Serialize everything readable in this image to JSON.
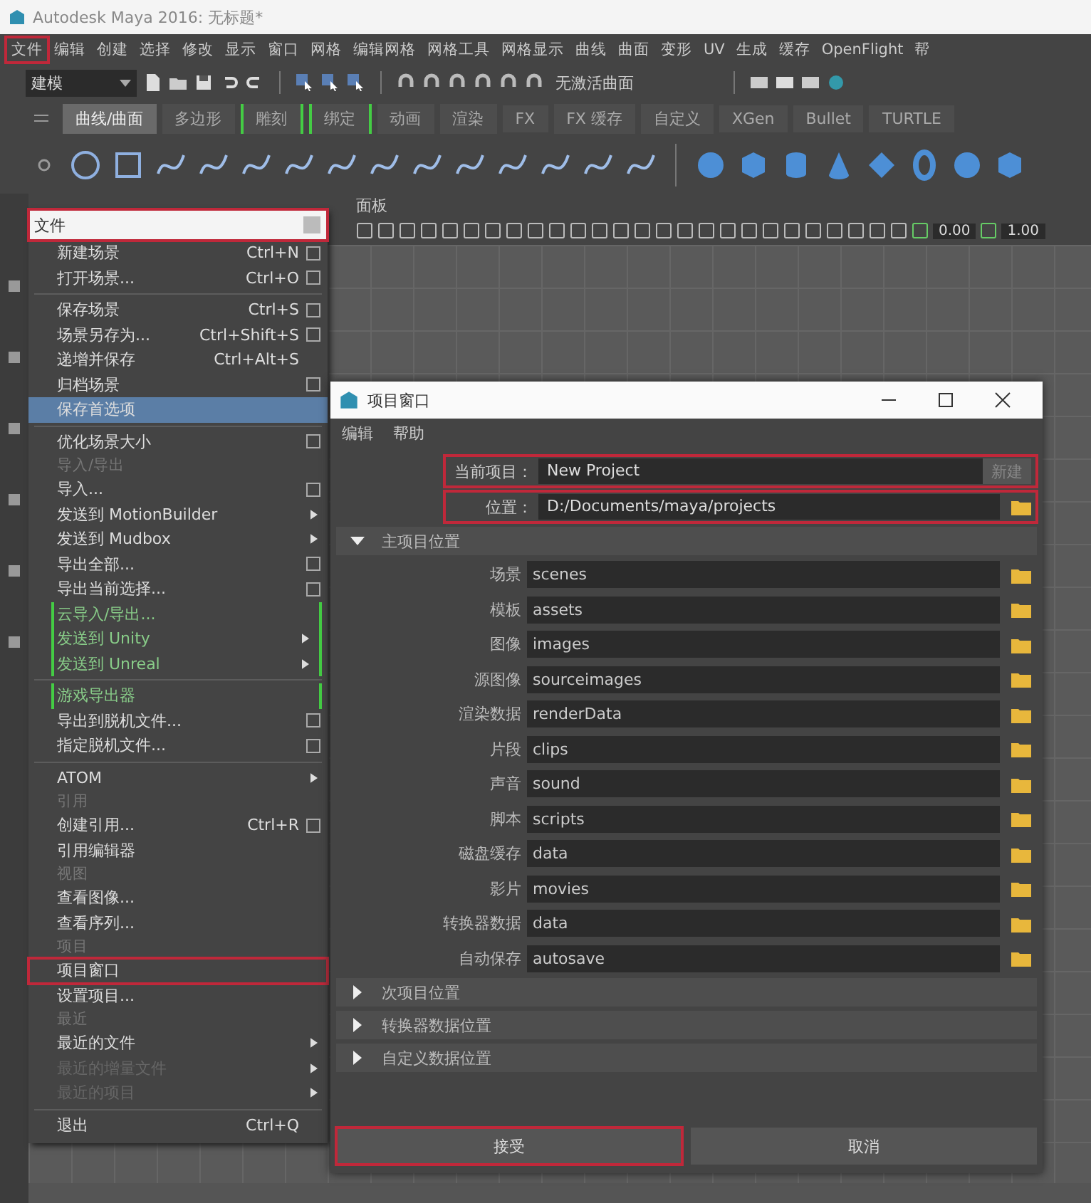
{
  "window": {
    "title": "Autodesk Maya 2016: 无标题*"
  },
  "menu_bar": [
    {
      "label": "文件",
      "highlighted": true
    },
    {
      "label": "编辑",
      "highlighted": false
    },
    {
      "label": "创建",
      "highlighted": false
    },
    {
      "label": "选择",
      "highlighted": false
    },
    {
      "label": "修改",
      "highlighted": false
    },
    {
      "label": "显示",
      "highlighted": false
    },
    {
      "label": "窗口",
      "highlighted": false
    },
    {
      "label": "网格",
      "highlighted": false
    },
    {
      "label": "编辑网格",
      "highlighted": false
    },
    {
      "label": "网格工具",
      "highlighted": false
    },
    {
      "label": "网格显示",
      "highlighted": false
    },
    {
      "label": "曲线",
      "highlighted": false
    },
    {
      "label": "曲面",
      "highlighted": false
    },
    {
      "label": "变形",
      "highlighted": false
    },
    {
      "label": "UV",
      "highlighted": false
    },
    {
      "label": "生成",
      "highlighted": false
    },
    {
      "label": "缓存",
      "highlighted": false
    },
    {
      "label": "OpenFlight",
      "highlighted": false
    },
    {
      "label": "帮",
      "highlighted": false
    }
  ],
  "status_line": {
    "mode": "建模",
    "surface_status": "无激活曲面"
  },
  "shelf_tabs": [
    {
      "label": "曲线/曲面",
      "selected": true,
      "kind": "plain"
    },
    {
      "label": "多边形",
      "selected": false,
      "kind": "plain"
    },
    {
      "label": "雕刻",
      "selected": false,
      "kind": "bracketed"
    },
    {
      "label": "绑定",
      "selected": false,
      "kind": "bracketed"
    },
    {
      "label": "动画",
      "selected": false,
      "kind": "plain"
    },
    {
      "label": "渲染",
      "selected": false,
      "kind": "plain"
    },
    {
      "label": "FX",
      "selected": false,
      "kind": "plain"
    },
    {
      "label": "FX 缓存",
      "selected": false,
      "kind": "plain"
    },
    {
      "label": "自定义",
      "selected": false,
      "kind": "plain"
    },
    {
      "label": "XGen",
      "selected": false,
      "kind": "plain"
    },
    {
      "label": "Bullet",
      "selected": false,
      "kind": "plain"
    },
    {
      "label": "TURTLE",
      "selected": false,
      "kind": "plain"
    }
  ],
  "panel_menu": [
    "面板"
  ],
  "panel_toolbar": {
    "values": [
      "0.00",
      "1.00"
    ]
  },
  "file_menu": {
    "title": "文件",
    "highlighted": true,
    "items": [
      {
        "kind": "item",
        "label": "新建场景",
        "shortcut": "Ctrl+N",
        "option_box": true,
        "submenu": false,
        "selected": false,
        "highlighted": false
      },
      {
        "kind": "item",
        "label": "打开场景...",
        "shortcut": "Ctrl+O",
        "option_box": true,
        "submenu": false,
        "selected": false,
        "highlighted": false
      },
      {
        "kind": "divider"
      },
      {
        "kind": "item",
        "label": "保存场景",
        "shortcut": "Ctrl+S",
        "option_box": true,
        "submenu": false,
        "selected": false,
        "highlighted": false
      },
      {
        "kind": "item",
        "label": "场景另存为...",
        "shortcut": "Ctrl+Shift+S",
        "option_box": true,
        "submenu": false,
        "selected": false,
        "highlighted": false
      },
      {
        "kind": "item",
        "label": "递增并保存",
        "shortcut": "Ctrl+Alt+S",
        "option_box": false,
        "submenu": false,
        "selected": false,
        "highlighted": false
      },
      {
        "kind": "item",
        "label": "归档场景",
        "option_box": true,
        "submenu": false,
        "selected": false,
        "highlighted": false
      },
      {
        "kind": "item",
        "label": "保存首选项",
        "option_box": false,
        "submenu": false,
        "selected": true,
        "highlighted": false
      },
      {
        "kind": "divider"
      },
      {
        "kind": "item",
        "label": "优化场景大小",
        "option_box": true,
        "submenu": false,
        "selected": false,
        "highlighted": false
      },
      {
        "kind": "section",
        "label": "导入/导出"
      },
      {
        "kind": "item",
        "label": "导入...",
        "option_box": true,
        "submenu": false,
        "selected": false,
        "highlighted": false
      },
      {
        "kind": "item",
        "label": "发送到 MotionBuilder",
        "option_box": false,
        "submenu": true,
        "selected": false,
        "highlighted": false
      },
      {
        "kind": "item",
        "label": "发送到 Mudbox",
        "option_box": false,
        "submenu": true,
        "selected": false,
        "highlighted": false
      },
      {
        "kind": "item",
        "label": "导出全部...",
        "option_box": true,
        "submenu": false,
        "selected": false,
        "highlighted": false
      },
      {
        "kind": "item",
        "label": "导出当前选择...",
        "option_box": true,
        "submenu": false,
        "selected": false,
        "highlighted": false
      },
      {
        "kind": "custom",
        "label": "云导入/导出...",
        "option_box": false,
        "submenu": false,
        "selected": false,
        "highlighted": false
      },
      {
        "kind": "custom",
        "label": "发送到 Unity",
        "option_box": false,
        "submenu": true,
        "selected": false,
        "highlighted": false
      },
      {
        "kind": "custom",
        "label": "发送到 Unreal",
        "option_box": false,
        "submenu": true,
        "selected": false,
        "highlighted": false
      },
      {
        "kind": "divider"
      },
      {
        "kind": "custom",
        "label": "游戏导出器",
        "option_box": false,
        "submenu": false,
        "selected": false,
        "highlighted": false
      },
      {
        "kind": "item",
        "label": "导出到脱机文件...",
        "option_box": true,
        "submenu": false,
        "selected": false,
        "highlighted": false
      },
      {
        "kind": "item",
        "label": "指定脱机文件...",
        "option_box": true,
        "submenu": false,
        "selected": false,
        "highlighted": false
      },
      {
        "kind": "divider"
      },
      {
        "kind": "item",
        "label": "ATOM",
        "option_box": false,
        "submenu": true,
        "selected": false,
        "highlighted": false
      },
      {
        "kind": "section",
        "label": "引用"
      },
      {
        "kind": "item",
        "label": "创建引用...",
        "shortcut": "Ctrl+R",
        "option_box": true,
        "submenu": false,
        "selected": false,
        "highlighted": false
      },
      {
        "kind": "item",
        "label": "引用编辑器",
        "option_box": false,
        "submenu": false,
        "selected": false,
        "highlighted": false
      },
      {
        "kind": "section",
        "label": "视图"
      },
      {
        "kind": "item",
        "label": "查看图像...",
        "option_box": false,
        "submenu": false,
        "selected": false,
        "highlighted": false
      },
      {
        "kind": "item",
        "label": "查看序列...",
        "option_box": false,
        "submenu": false,
        "selected": false,
        "highlighted": false
      },
      {
        "kind": "section",
        "label": "项目"
      },
      {
        "kind": "item",
        "label": "项目窗口",
        "option_box": false,
        "submenu": false,
        "selected": false,
        "highlighted": true
      },
      {
        "kind": "item",
        "label": "设置项目...",
        "option_box": false,
        "submenu": false,
        "selected": false,
        "highlighted": false
      },
      {
        "kind": "section",
        "label": "最近"
      },
      {
        "kind": "item",
        "label": "最近的文件",
        "option_box": false,
        "submenu": true,
        "selected": false,
        "highlighted": false
      },
      {
        "kind": "disabled",
        "label": "最近的增量文件",
        "option_box": false,
        "submenu": true,
        "selected": false,
        "highlighted": false
      },
      {
        "kind": "disabled",
        "label": "最近的项目",
        "option_box": false,
        "submenu": true,
        "selected": false,
        "highlighted": false
      },
      {
        "kind": "divider"
      },
      {
        "kind": "item",
        "label": "退出",
        "shortcut": "Ctrl+Q",
        "option_box": false,
        "submenu": false,
        "selected": false,
        "highlighted": false
      }
    ]
  },
  "project_window": {
    "title": "项目窗口",
    "menu": [
      "编辑",
      "帮助"
    ],
    "current_project": {
      "label": "当前项目：",
      "value": "New Project",
      "button": "新建",
      "highlighted": true
    },
    "location": {
      "label": "位置：",
      "value": "D:/Documents/maya/projects",
      "highlighted": true
    },
    "sections": [
      {
        "label": "主项目位置",
        "expanded": true,
        "rows": [
          {
            "label": "场景",
            "value": "scenes"
          },
          {
            "label": "模板",
            "value": "assets"
          },
          {
            "label": "图像",
            "value": "images"
          },
          {
            "label": "源图像",
            "value": "sourceimages"
          },
          {
            "label": "渲染数据",
            "value": "renderData"
          },
          {
            "label": "片段",
            "value": "clips"
          },
          {
            "label": "声音",
            "value": "sound"
          },
          {
            "label": "脚本",
            "value": "scripts"
          },
          {
            "label": "磁盘缓存",
            "value": "data"
          },
          {
            "label": "影片",
            "value": "movies"
          },
          {
            "label": "转换器数据",
            "value": "data"
          },
          {
            "label": "自动保存",
            "value": "autosave"
          }
        ]
      },
      {
        "label": "次项目位置",
        "expanded": false
      },
      {
        "label": "转换器数据位置",
        "expanded": false
      },
      {
        "label": "自定义数据位置",
        "expanded": false
      }
    ],
    "buttons": [
      {
        "label": "接受",
        "highlighted": true
      },
      {
        "label": "取消",
        "highlighted": false
      }
    ]
  }
}
